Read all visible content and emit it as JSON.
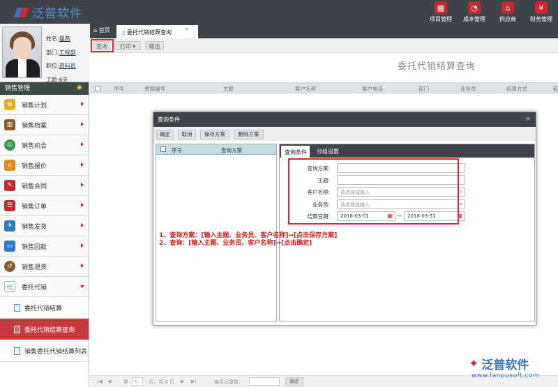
{
  "app": {
    "logo_text": "泛普软件"
  },
  "topnav": [
    {
      "label": "项目管理",
      "icon": "building-icon"
    },
    {
      "label": "成本管理",
      "icon": "pie-chart-icon"
    },
    {
      "label": "供应商",
      "icon": "home-icon"
    },
    {
      "label": "财务管理",
      "icon": "yen-icon"
    }
  ],
  "profile": {
    "name_label": "姓名:",
    "name": "曼燕",
    "dept_label": "部门:",
    "dept": "工程部",
    "position_label": "职位:",
    "position": "资料员",
    "age_label": "工龄:",
    "age": "6天"
  },
  "sidebar": {
    "title": "销售管理",
    "items": [
      {
        "label": "销售计划",
        "color": "#e0b020"
      },
      {
        "label": "销售档案",
        "color": "#8a5a2a"
      },
      {
        "label": "销售机会",
        "color": "#2f9a4a"
      },
      {
        "label": "销售报价",
        "color": "#e08a20"
      },
      {
        "label": "销售合同",
        "color": "#c8282b"
      },
      {
        "label": "销售订单",
        "color": "#c8282b"
      },
      {
        "label": "销售发货",
        "color": "#2a7ac8"
      },
      {
        "label": "销售回款",
        "color": "#2a7ac8"
      },
      {
        "label": "销售退货",
        "color": "#8a5a2a"
      },
      {
        "label": "委托代销",
        "color": "#8fbf8f",
        "icon_text": "代"
      }
    ],
    "subitems": [
      "委托代销结算",
      "委托代销结算查询",
      "销售委托代销结算列表"
    ]
  },
  "tabs": {
    "home": "首页",
    "current": "委托代销结算查询",
    "close": "×"
  },
  "toolbar": {
    "query": "查询",
    "print": "打印",
    "export": "输出"
  },
  "page_title": "委托代销结算查询",
  "table_headers": [
    "序号",
    "单据编号",
    "主题",
    "客户名称",
    "客户电话",
    "部门",
    "业务员",
    "结算方式",
    "结"
  ],
  "footer": {
    "page_prefix": "第",
    "page_value": "0",
    "page_suffix": "页，共 0 页",
    "per_page": "每页记录数:",
    "confirm": "确定"
  },
  "watermark": {
    "brand": "泛普软件",
    "url": "www.fanpusoft.com"
  },
  "modal": {
    "title": "查询条件",
    "close": "×",
    "buttons": [
      "确定",
      "取消",
      "保存方案",
      "删除方案"
    ],
    "left_headers": [
      "序号",
      "查询方案"
    ],
    "right_tabs": [
      "查询条件",
      "分组设置"
    ],
    "fields": {
      "scheme_label": "查询方案:",
      "subject_label": "主题:",
      "customer_label": "客户名称:",
      "customer_placeholder": "请选择或输入",
      "sales_label": "业务员:",
      "sales_placeholder": "请选择或输入",
      "date_label": "结算日期:",
      "date_from": "2018-03-01",
      "date_sep": "—",
      "date_to": "2018-03-31"
    }
  },
  "annotation": {
    "line1": "1、查询方案：[输入主题、业务员、客户名称]→[点击保存方案]",
    "line2": "2、查询：[输入主题、业务员、客户名称]→[点击确定]"
  },
  "colors": {
    "topbar": "#3e4449",
    "accent_red": "#c8282b",
    "highlight_box": "#e3262e"
  }
}
